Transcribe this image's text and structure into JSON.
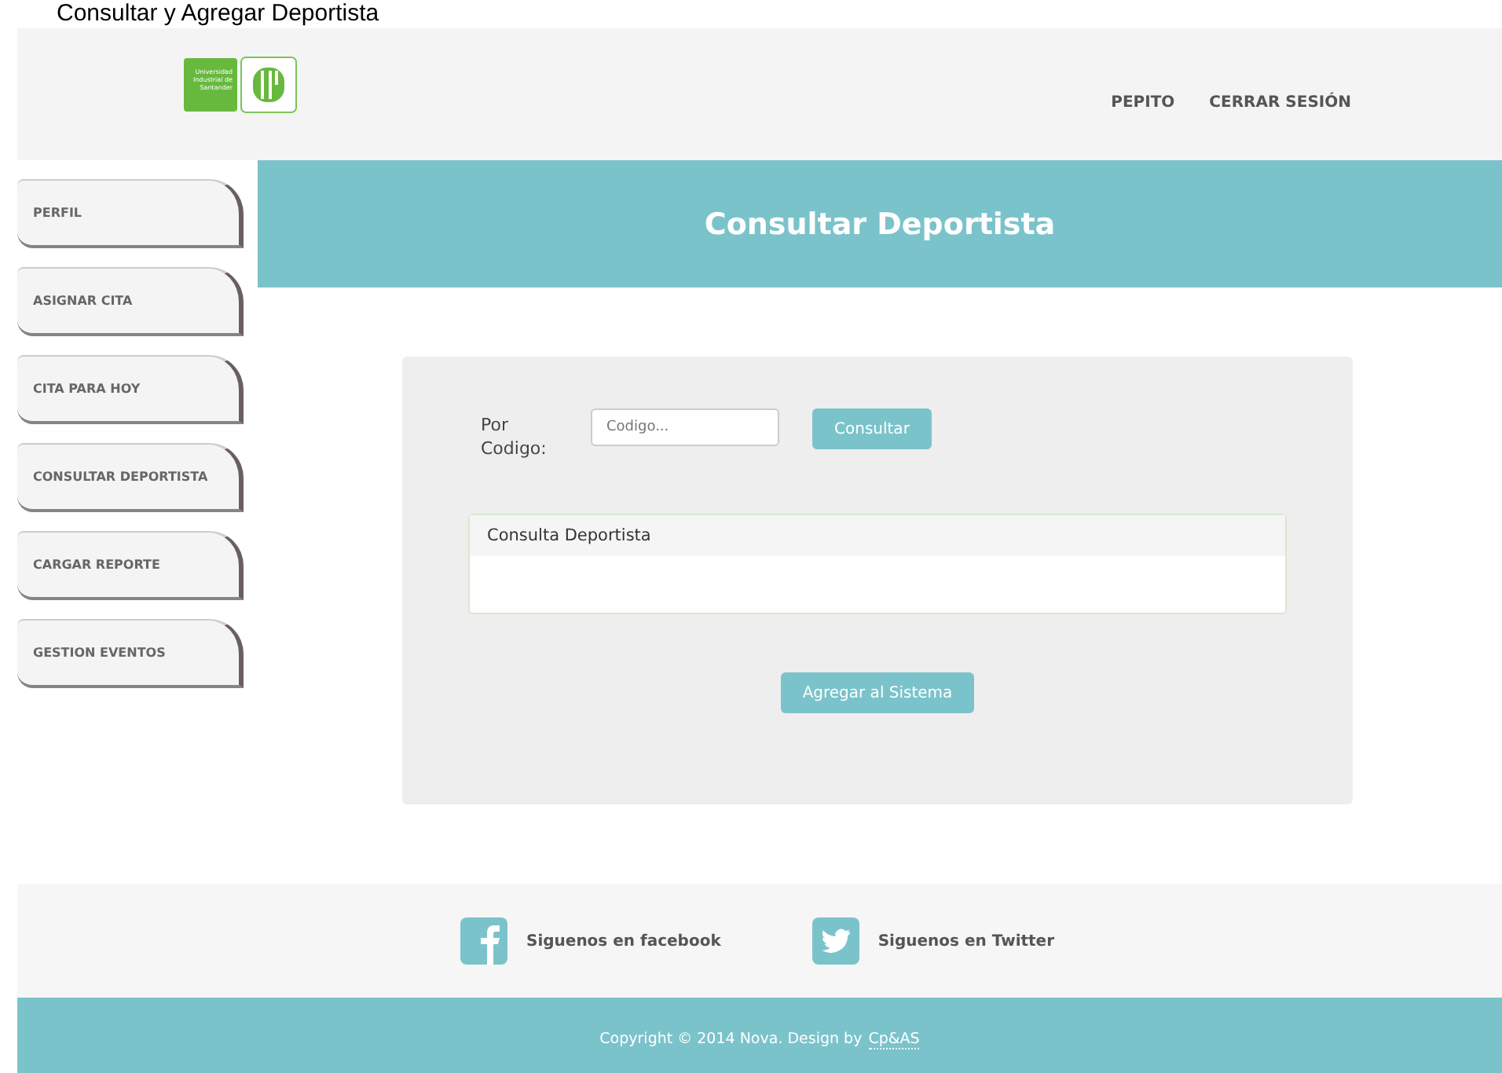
{
  "caption": "Consultar y Agregar Deportista",
  "header": {
    "logo_text": "Universidad Industrial de Santander",
    "nav": [
      {
        "label": "PEPITO"
      },
      {
        "label": "CERRAR SESIÓN"
      }
    ]
  },
  "sidebar": {
    "items": [
      {
        "label": "PERFIL"
      },
      {
        "label": "ASIGNAR CITA"
      },
      {
        "label": "CITA PARA HOY"
      },
      {
        "label": "CONSULTAR DEPORTISTA"
      },
      {
        "label": "CARGAR REPORTE"
      },
      {
        "label": "GESTION EVENTOS"
      }
    ]
  },
  "banner": {
    "title": "Consultar Deportista"
  },
  "form": {
    "label": "Por Codigo:",
    "placeholder": "Codigo...",
    "button": "Consultar",
    "panel_title": "Consulta Deportista",
    "add_button": "Agregar al Sistema"
  },
  "footer": {
    "social": [
      {
        "kind": "facebook",
        "label": "Siguenos en facebook"
      },
      {
        "kind": "twitter",
        "label": "Siguenos en Twitter"
      }
    ],
    "copyright": "Copyright © 2014 Nova. Design by",
    "credit_link": "Cp&AS"
  }
}
